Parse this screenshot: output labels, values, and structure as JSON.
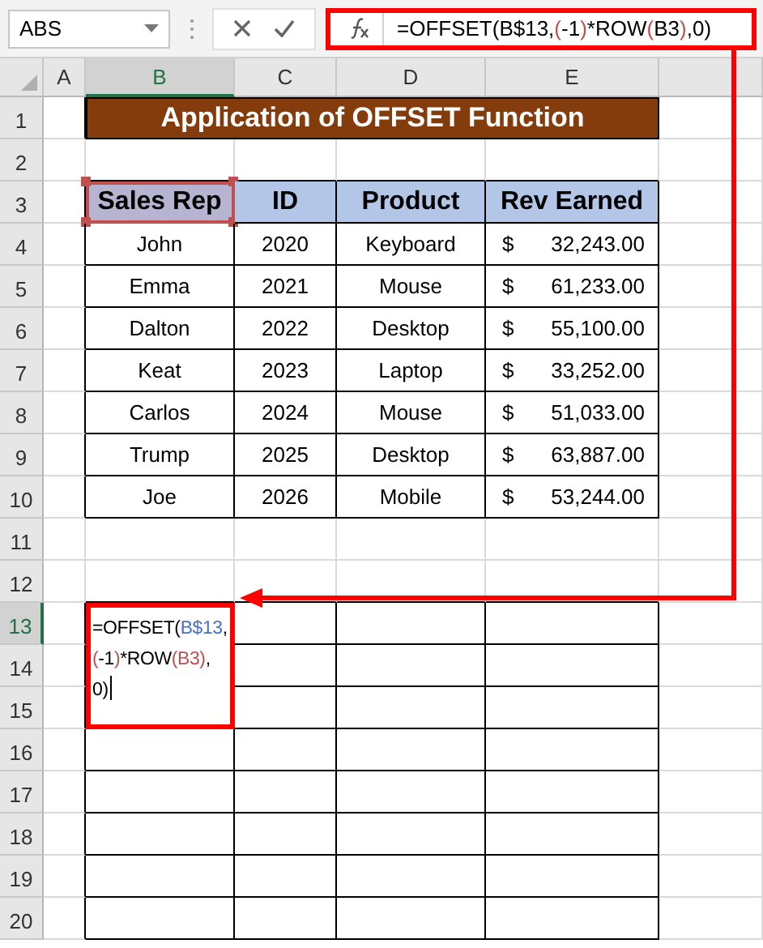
{
  "name_box": "ABS",
  "formula_bar": {
    "parts": [
      {
        "text": "=OFFSET(B$13,",
        "color": "#000000"
      },
      {
        "text": "(",
        "color": "#c0504d"
      },
      {
        "text": "-1",
        "color": "#000000"
      },
      {
        "text": ")",
        "color": "#c0504d"
      },
      {
        "text": "*ROW",
        "color": "#000000"
      },
      {
        "text": "(",
        "color": "#c0504d"
      },
      {
        "text": "B3",
        "color": "#000000"
      },
      {
        "text": ")",
        "color": "#c0504d"
      },
      {
        "text": ",0)",
        "color": "#000000"
      }
    ]
  },
  "columns": [
    {
      "label": "A",
      "selected": false
    },
    {
      "label": "B",
      "selected": true
    },
    {
      "label": "C",
      "selected": false
    },
    {
      "label": "D",
      "selected": false
    },
    {
      "label": "E",
      "selected": false
    }
  ],
  "rows": [
    {
      "label": "1",
      "selected": false
    },
    {
      "label": "2",
      "selected": false
    },
    {
      "label": "3",
      "selected": false
    },
    {
      "label": "4",
      "selected": false
    },
    {
      "label": "5",
      "selected": false
    },
    {
      "label": "6",
      "selected": false
    },
    {
      "label": "7",
      "selected": false
    },
    {
      "label": "8",
      "selected": false
    },
    {
      "label": "9",
      "selected": false
    },
    {
      "label": "10",
      "selected": false
    },
    {
      "label": "11",
      "selected": false
    },
    {
      "label": "12",
      "selected": false
    },
    {
      "label": "13",
      "selected": true
    },
    {
      "label": "14",
      "selected": false
    },
    {
      "label": "15",
      "selected": false
    },
    {
      "label": "16",
      "selected": false
    },
    {
      "label": "17",
      "selected": false
    },
    {
      "label": "18",
      "selected": false
    },
    {
      "label": "19",
      "selected": false
    },
    {
      "label": "20",
      "selected": false
    }
  ],
  "title": "Application of OFFSET Function",
  "table": {
    "columns": [
      {
        "label": "Sales Rep",
        "highlighted": true
      },
      {
        "label": "ID",
        "highlighted": false
      },
      {
        "label": "Product",
        "highlighted": false
      },
      {
        "label": "Rev Earned",
        "highlighted": false
      }
    ],
    "rows": [
      {
        "sales_rep": "John",
        "id": "2020",
        "product": "Keyboard",
        "currency": "$",
        "amount": "32,243.00"
      },
      {
        "sales_rep": "Emma",
        "id": "2021",
        "product": "Mouse",
        "currency": "$",
        "amount": "61,233.00"
      },
      {
        "sales_rep": "Dalton",
        "id": "2022",
        "product": "Desktop",
        "currency": "$",
        "amount": "55,100.00"
      },
      {
        "sales_rep": "Keat",
        "id": "2023",
        "product": "Laptop",
        "currency": "$",
        "amount": "33,252.00"
      },
      {
        "sales_rep": "Carlos",
        "id": "2024",
        "product": "Mouse",
        "currency": "$",
        "amount": "51,033.00"
      },
      {
        "sales_rep": "Trump",
        "id": "2025",
        "product": "Desktop",
        "currency": "$",
        "amount": "63,887.00"
      },
      {
        "sales_rep": "Joe",
        "id": "2026",
        "product": "Mobile",
        "currency": "$",
        "amount": "53,244.00"
      }
    ]
  },
  "editing_cell": {
    "cursor": true,
    "lines": [
      [
        {
          "text": "=OFFSET(",
          "color": "#000000"
        },
        {
          "text": "B$13",
          "color": "#4472c4"
        },
        {
          "text": ",",
          "color": "#000000"
        }
      ],
      [
        {
          "text": "(",
          "color": "#c0504d"
        },
        {
          "text": "-1",
          "color": "#000000"
        },
        {
          "text": ")",
          "color": "#c0504d"
        },
        {
          "text": "*ROW",
          "color": "#000000"
        },
        {
          "text": "(B3)",
          "color": "#c0504d"
        },
        {
          "text": ",",
          "color": "#000000"
        }
      ],
      [
        {
          "text": "0)",
          "color": "#000000"
        }
      ]
    ]
  }
}
